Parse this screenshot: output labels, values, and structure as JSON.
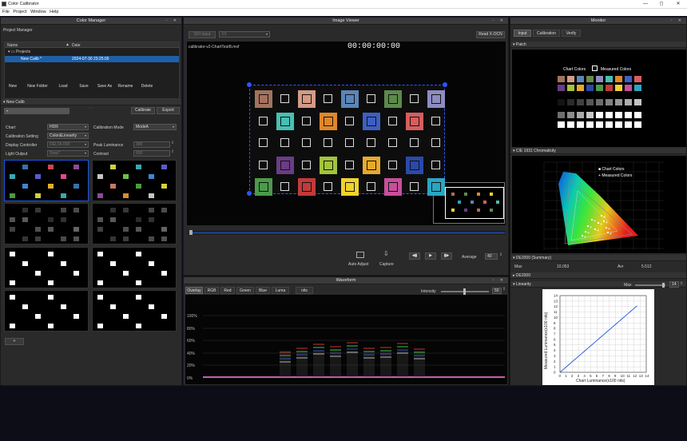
{
  "app": {
    "title": "Color Calibrator",
    "win_min": "—",
    "win_max": "◻",
    "win_close": "✕"
  },
  "menu": [
    "File",
    "Project",
    "Window",
    "Help"
  ],
  "color_manager": {
    "title": "Color Manager",
    "project_manager": "Project Manager",
    "col_name": "Name",
    "col_date": "Date",
    "tree_root": "Projects",
    "tree_item": "New Calib *",
    "tree_item_date": "2024-07-30 23:25:05",
    "buttons": [
      "New",
      "New Folder",
      "Load",
      "Save",
      "Save As",
      "Rename",
      "Delete"
    ],
    "section": "New Calib",
    "calibrate": "Calibrate",
    "export": "Export",
    "fields": {
      "chart_label": "Chart",
      "chart_value": "HDR",
      "mode_label": "Calibration Mode",
      "mode_value": "ModeA",
      "setting_label": "Calibration Setting",
      "setting_value": "Color&Linearity",
      "display_label": "Display Controller",
      "display_value": "DELTA-000",
      "peak_label": "Peak Luminance",
      "peak_value": "300",
      "light_label": "Light Output",
      "light_value": "Step7",
      "contrast_label": "Contrast",
      "contrast_value": "600"
    },
    "add_button": "+"
  },
  "image_viewer": {
    "title": "Image Viewer",
    "sdi": "SDI Input",
    "sdi_sel": "1/1",
    "read": "Read X-OCN",
    "file": "calibrator-v2-ChartTestB.mxf",
    "timecode": "00:00:00:00",
    "auto_adjust": "Auto Adjust",
    "capture": "Capture",
    "average_label": "Average",
    "average_value": "40"
  },
  "waveform": {
    "title": "Waveform",
    "tabs": [
      "Overlay",
      "RGB",
      "Red",
      "Green",
      "Blue",
      "Luma"
    ],
    "nits": "nits",
    "intensity_label": "Intensity",
    "intensity_value": "50",
    "y_ticks": [
      "100%",
      "80%",
      "60%",
      "40%",
      "20%",
      "0%"
    ]
  },
  "monitor": {
    "title": "Monitor",
    "tabs": [
      "Input",
      "Calibration",
      "Verify"
    ],
    "patch_section": "Patch",
    "chart_colors": "Chart Colors",
    "measured_colors": "Measured Colors",
    "cie_section": "CIE 1931 Chromaticity",
    "legend_chart": "Chart Colors",
    "legend_measured": "Measured Colors",
    "de_section": "DE2000 (Summary)",
    "max_label": "Max",
    "max_value": "10.053",
    "avr_label": "Avr",
    "avr_value": "5.512",
    "de2000": "DE2000",
    "linearity": "Linearity",
    "lin_max": "Max",
    "lin_value": "14",
    "axis_y": "Measured Luminance(x100 nits)",
    "axis_x": "Chart Luminance(x100 nits)",
    "ticks": [
      "0",
      "1",
      "2",
      "3",
      "4",
      "5",
      "6",
      "7",
      "8",
      "9",
      "10",
      "11",
      "12",
      "13",
      "14"
    ]
  },
  "colors": {
    "accent": "#1d55d8",
    "selection": "#1e5fa8"
  }
}
